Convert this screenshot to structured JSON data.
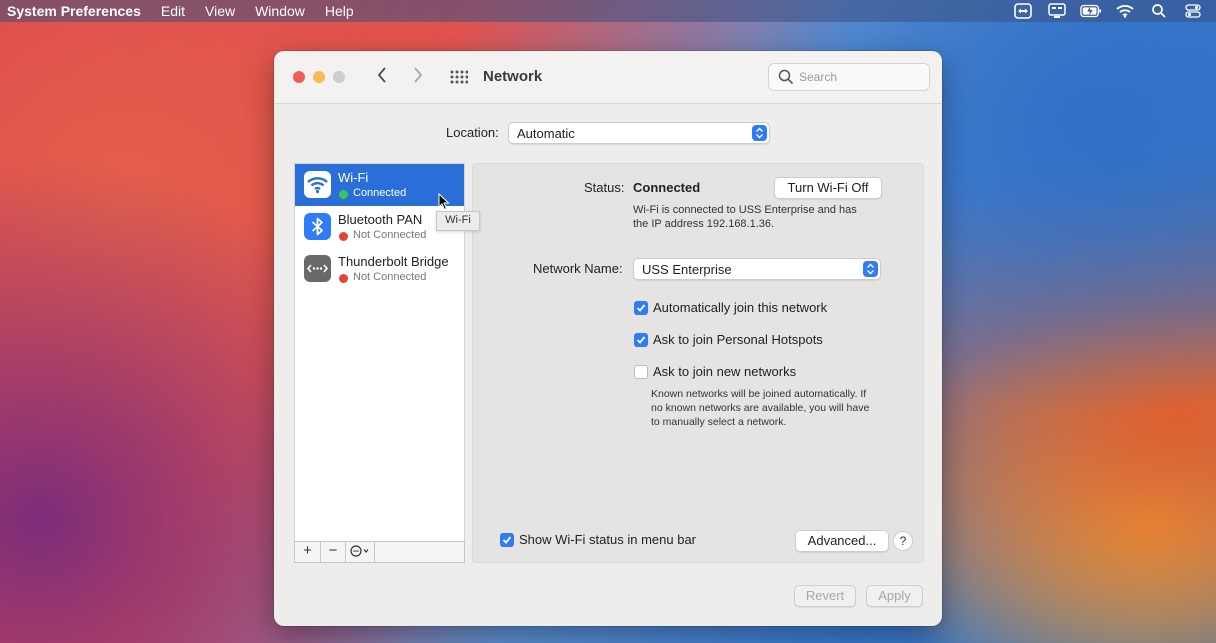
{
  "menubar": {
    "app": "System Preferences",
    "menus": [
      "Edit",
      "View",
      "Window",
      "Help"
    ],
    "status_icons": [
      "teamviewer-icon",
      "screen-mirror-icon",
      "battery-icon",
      "wifi-icon",
      "spotlight-icon",
      "control-center-icon"
    ]
  },
  "window": {
    "title": "Network",
    "search_placeholder": "Search"
  },
  "location": {
    "label": "Location:",
    "value": "Automatic"
  },
  "services": [
    {
      "name": "Wi-Fi",
      "status": "Connected",
      "status_color": "#34c759",
      "icon": "wifi-icon",
      "selected": true
    },
    {
      "name": "Bluetooth PAN",
      "status": "Not Connected",
      "status_color": "#e0443a",
      "icon": "bluetooth-icon",
      "selected": false
    },
    {
      "name": "Thunderbolt Bridge",
      "status": "Not Connected",
      "status_color": "#e0443a",
      "icon": "thunderbolt-bridge-icon",
      "selected": false
    }
  ],
  "sidebar_buttons": [
    "+",
    "−"
  ],
  "tooltip": "Wi-Fi",
  "detail": {
    "status_label": "Status:",
    "status_value": "Connected",
    "turn_off_label": "Turn Wi-Fi Off",
    "status_desc_line1": "Wi-Fi is connected to USS Enterprise and has",
    "status_desc_line2": "the IP address 192.168.1.36.",
    "network_name_label": "Network Name:",
    "network_name_value": "USS Enterprise",
    "auto_join_label": "Automatically join this network",
    "auto_join": true,
    "hotspots_label": "Ask to join Personal Hotspots",
    "hotspots": true,
    "new_networks_label": "Ask to join new networks",
    "new_networks": false,
    "new_networks_desc_line1": "Known networks will be joined automatically. If",
    "new_networks_desc_line2": "no known networks are available, you will have",
    "new_networks_desc_line3": "to manually select a network.",
    "show_status_label": "Show Wi-Fi status in menu bar",
    "show_status": true,
    "advanced_label": "Advanced...",
    "help_label": "?"
  },
  "footer": {
    "revert_label": "Revert",
    "apply_label": "Apply"
  },
  "colors": {
    "accent": "#2f7cf6",
    "selection": "#2a6fd8"
  }
}
